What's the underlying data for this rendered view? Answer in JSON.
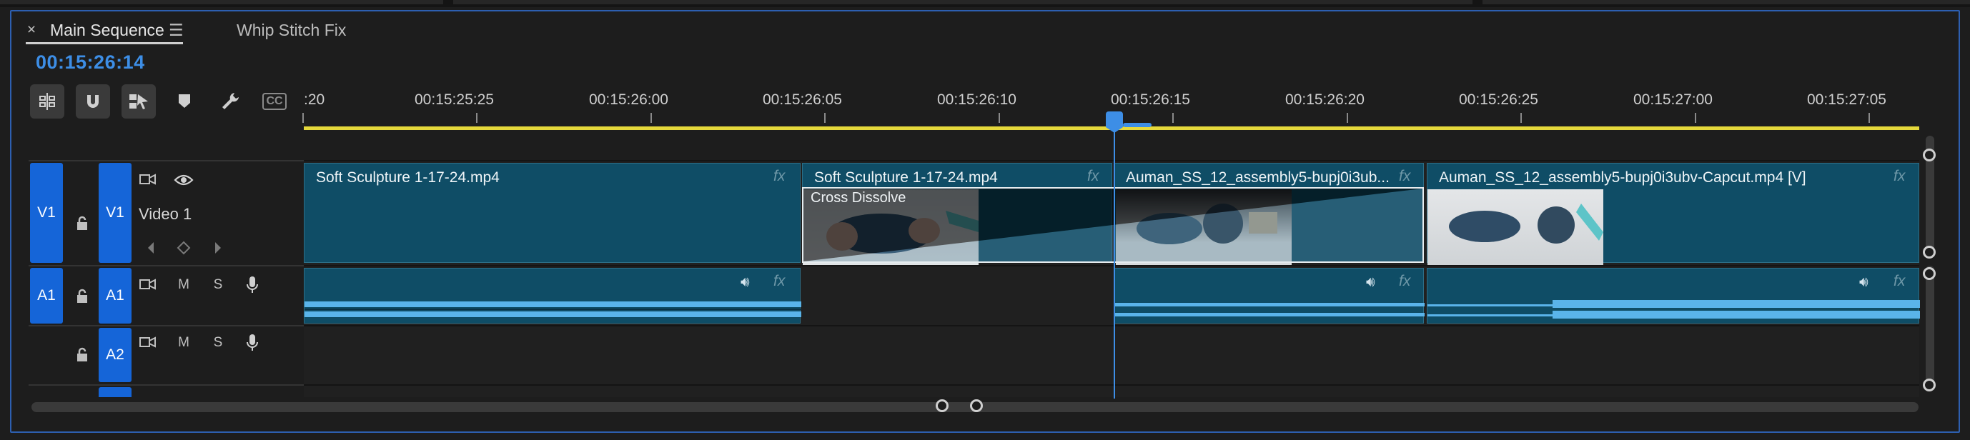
{
  "tabs": {
    "close_glyph": "×",
    "active_title": "Main Sequence",
    "menu_glyph": "☰",
    "inactive_title": "Whip Stitch Fix"
  },
  "timecode": "00:15:26:14",
  "toolbar": {
    "items": [
      "insert-sequence-nested-icon",
      "snap-magnet-icon",
      "linked-selection-icon",
      "marker-icon",
      "wrench-settings-icon",
      "captions-icon"
    ],
    "captions_label": "CC"
  },
  "ruler": {
    "labels": [
      ":20",
      "00:15:25:25",
      "00:15:26:00",
      "00:15:26:05",
      "00:15:26:10",
      "00:15:26:15",
      "00:15:26:20",
      "00:15:26:25",
      "00:15:27:00",
      "00:15:27:05"
    ]
  },
  "tracks": {
    "v1": {
      "source": "V1",
      "target": "V1",
      "name": "Video 1"
    },
    "a1": {
      "source": "A1",
      "target": "A1",
      "mute": "M",
      "solo": "S"
    },
    "a2": {
      "target": "A2",
      "mute": "M",
      "solo": "S"
    }
  },
  "clips": {
    "video": [
      {
        "name": "Soft Sculpture 1-17-24.mp4",
        "fx": "fx"
      },
      {
        "name": "Soft Sculpture 1-17-24.mp4",
        "fx": "fx",
        "transition": "Cross Dissolve"
      },
      {
        "name": "Auman_SS_12_assembly5-bupj0i3ub...",
        "fx": "fx"
      },
      {
        "name": "Auman_SS_12_assembly5-bupj0i3ubv-Capcut.mp4 [V]",
        "fx": "fx"
      }
    ],
    "audio": [
      {
        "fx": "fx"
      },
      {
        "fx": "fx"
      },
      {
        "fx": "fx"
      }
    ]
  },
  "colors": {
    "accent": "#3d8ee6",
    "track_target": "#1565d8",
    "clip": "#0f4d66",
    "work_area": "#e5d83b",
    "waveform": "#5ab4ea"
  }
}
